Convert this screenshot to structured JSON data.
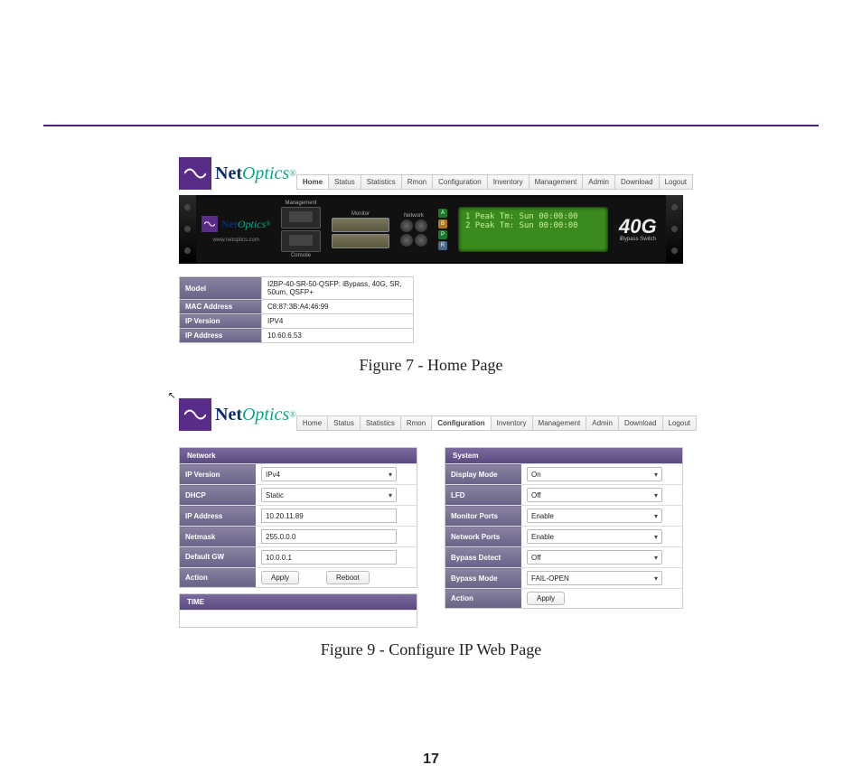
{
  "page_number": "17",
  "captions": {
    "fig7": "Figure 7 - Home Page",
    "fig9": "Figure 9 - Configure IP Web Page"
  },
  "logo": {
    "net": "Net",
    "optics": "Optics",
    "reg": "®"
  },
  "nav": {
    "items": [
      "Home",
      "Status",
      "Statistics",
      "Rmon",
      "Configuration",
      "Inventory",
      "Management",
      "Admin",
      "Download",
      "Logout"
    ],
    "active_fig7": "Home",
    "active_fig9": "Configuration"
  },
  "device": {
    "url": "www.netoptics.com",
    "sections": {
      "management": "Management",
      "console": "Console",
      "monitor": "Monitor",
      "network": "Network"
    },
    "leds": {
      "a": "A",
      "b": "B",
      "p": "P",
      "r": "R"
    },
    "lcd": {
      "line1": "1 Peak Tm: Sun 00:00:00",
      "line2": "2 Peak Tm: Sun 00:00:00"
    },
    "tag": {
      "big": "40G",
      "sub": "iBypass Switch"
    }
  },
  "info_table": [
    {
      "label": "Model",
      "value": "I2BP-40-SR-50-QSFP: iBypass, 40G, SR, 50um, QSFP+"
    },
    {
      "label": "MAC Address",
      "value": "C8:87:3B:A4:46:99"
    },
    {
      "label": "IP Version",
      "value": "IPV4"
    },
    {
      "label": "IP Address",
      "value": "10.60.6.53"
    }
  ],
  "fig9": {
    "network": {
      "title": "Network",
      "rows": {
        "ip_version": {
          "label": "IP Version",
          "value": "IPv4"
        },
        "dhcp": {
          "label": "DHCP",
          "value": "Static"
        },
        "ip_address": {
          "label": "IP Address",
          "value": "10.20.11.89"
        },
        "netmask": {
          "label": "Netmask",
          "value": "255.0.0.0"
        },
        "default_gw": {
          "label": "Default GW",
          "value": "10.0.0.1"
        },
        "action": {
          "label": "Action",
          "apply": "Apply",
          "reboot": "Reboot"
        }
      }
    },
    "time_title": "TIME",
    "system": {
      "title": "System",
      "rows": {
        "display_mode": {
          "label": "Display Mode",
          "value": "On"
        },
        "lfd": {
          "label": "LFD",
          "value": "Off"
        },
        "monitor_ports": {
          "label": "Monitor Ports",
          "value": "Enable"
        },
        "network_ports": {
          "label": "Network Ports",
          "value": "Enable"
        },
        "bypass_detect": {
          "label": "Bypass Detect",
          "value": "Off"
        },
        "bypass_mode": {
          "label": "Bypass Mode",
          "value": "FAIL-OPEN"
        },
        "action": {
          "label": "Action",
          "apply": "Apply"
        }
      }
    }
  }
}
